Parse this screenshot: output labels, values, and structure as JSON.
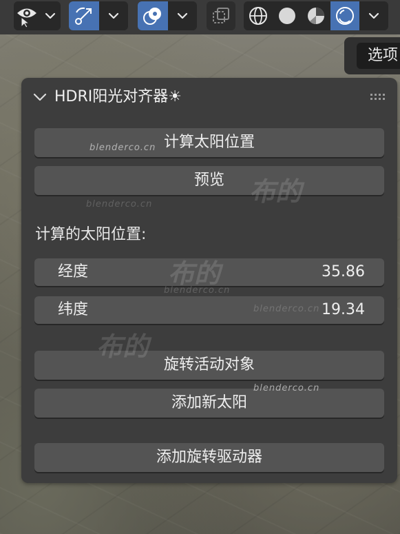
{
  "header": {
    "icons": {
      "visibility": "eye-icon",
      "gizmo": "gizmo-arrow-icon",
      "overlay": "overlay-circles-icon",
      "xray": "xray-toggle-icon",
      "shading_wireframe": "wireframe-sphere-icon",
      "shading_solid": "solid-sphere-icon",
      "shading_material": "material-sphere-icon",
      "shading_rendered": "rendered-sphere-icon"
    },
    "active_color": "#4772b3"
  },
  "sidebar_tab": {
    "label": "选项"
  },
  "panel": {
    "title": "HDRI阳光对齐器☀",
    "calculate_button": "计算太阳位置",
    "preview_button": "预览",
    "section_label": "计算的太阳位置:",
    "longitude": {
      "label": "经度",
      "value": "35.86"
    },
    "latitude": {
      "label": "纬度",
      "value": "19.34"
    },
    "rotate_button": "旋转活动对象",
    "add_sun_button": "添加新太阳",
    "add_driver_button": "添加旋转驱动器"
  },
  "watermarks": {
    "site": "blenderco.cn",
    "brand": "布的"
  }
}
